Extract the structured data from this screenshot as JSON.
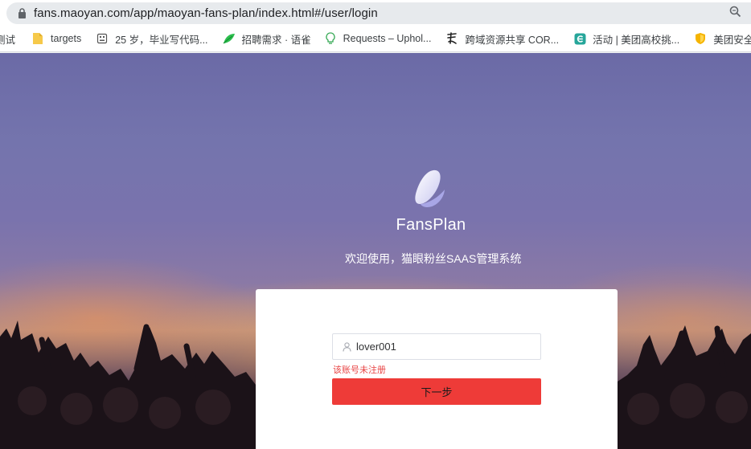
{
  "browser": {
    "url": "fans.maoyan.com/app/maoyan-fans-plan/index.html#/user/login"
  },
  "bookmarks": [
    {
      "label": "测试",
      "icon": "bookmark-icon"
    },
    {
      "label": "targets",
      "icon": "folder-icon"
    },
    {
      "label": "25 岁，毕业写代码...",
      "icon": "robot-icon"
    },
    {
      "label": "招聘需求 · 语雀",
      "icon": "leaf-icon"
    },
    {
      "label": "Requests – Uphol...",
      "icon": "bulb-icon"
    },
    {
      "label": "跨域资源共享 COR...",
      "icon": "calligraphy-icon"
    },
    {
      "label": "活动 | 美团高校挑...",
      "icon": "e-icon"
    },
    {
      "label": "美团安全应急",
      "icon": "shield-icon"
    }
  ],
  "login": {
    "brand": "FansPlan",
    "welcome": "欢迎使用，猫眼粉丝SAAS管理系统",
    "username_value": "lover001",
    "error_text": "该账号未注册",
    "next_button": "下一步"
  },
  "colors": {
    "accent": "#ee3b38",
    "error": "#e84545"
  }
}
